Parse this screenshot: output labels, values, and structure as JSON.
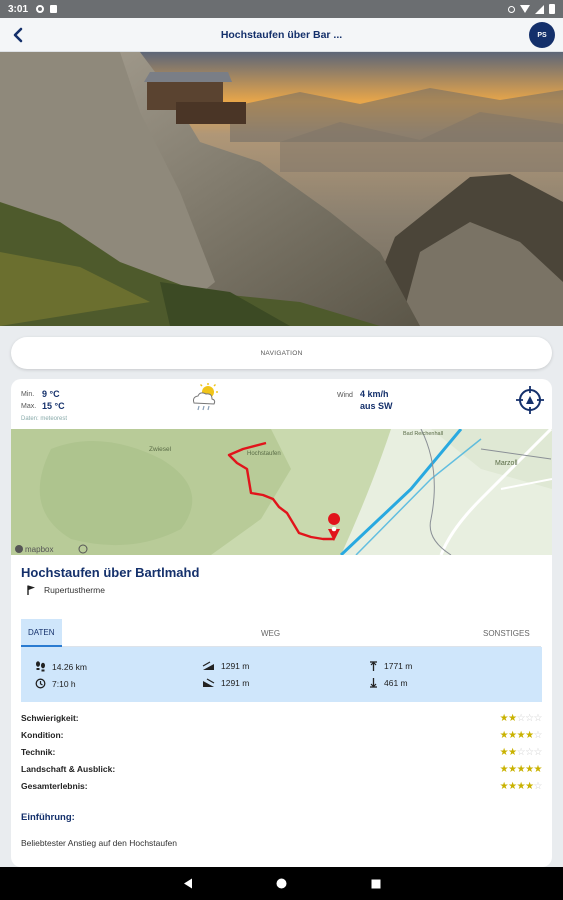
{
  "status_bar": {
    "time": "3:01"
  },
  "app_bar": {
    "title": "Hochstaufen über Bar ...",
    "avatar": "PS"
  },
  "navigation_button": "NAVIGATION",
  "weather": {
    "min_label": "Min.",
    "min_value": "9 °C",
    "max_label": "Max.",
    "max_value": "15 °C",
    "source": "Daten: meteorest",
    "wind_label": "Wind",
    "wind_speed": "4 km/h",
    "wind_direction": "aus SW"
  },
  "map": {
    "labels": [
      "Zwiesel",
      "Hochstaufen",
      "Marzoll",
      "Bad Reichenhall"
    ],
    "attribution": "mapbox"
  },
  "tour": {
    "title": "Hochstaufen über Bartlmahd",
    "start": "Rupertustherme"
  },
  "tabs": [
    {
      "label": "DATEN",
      "active": true
    },
    {
      "label": "WEG",
      "active": false
    },
    {
      "label": "SONSTIGES",
      "active": false
    }
  ],
  "stats": {
    "distance": "14.26 km",
    "duration": "7:10 h",
    "ascent": "1291 m",
    "descent": "1291 m",
    "max_altitude": "1771 m",
    "min_altitude": "461 m"
  },
  "ratings": [
    {
      "label": "Schwierigkeit:",
      "stars": 2
    },
    {
      "label": "Kondition:",
      "stars": 4
    },
    {
      "label": "Technik:",
      "stars": 2
    },
    {
      "label": "Landschaft & Ausblick:",
      "stars": 5
    },
    {
      "label": "Gesamterlebnis:",
      "stars": 4
    }
  ],
  "intro": {
    "heading": "Einführung:",
    "text": "Beliebtester Anstieg auf den Hochstaufen"
  },
  "colors": {
    "brand": "#14306b",
    "tab_active_bg": "#cfe6fb",
    "star_on": "#c9b200",
    "route": "#e1141b"
  }
}
